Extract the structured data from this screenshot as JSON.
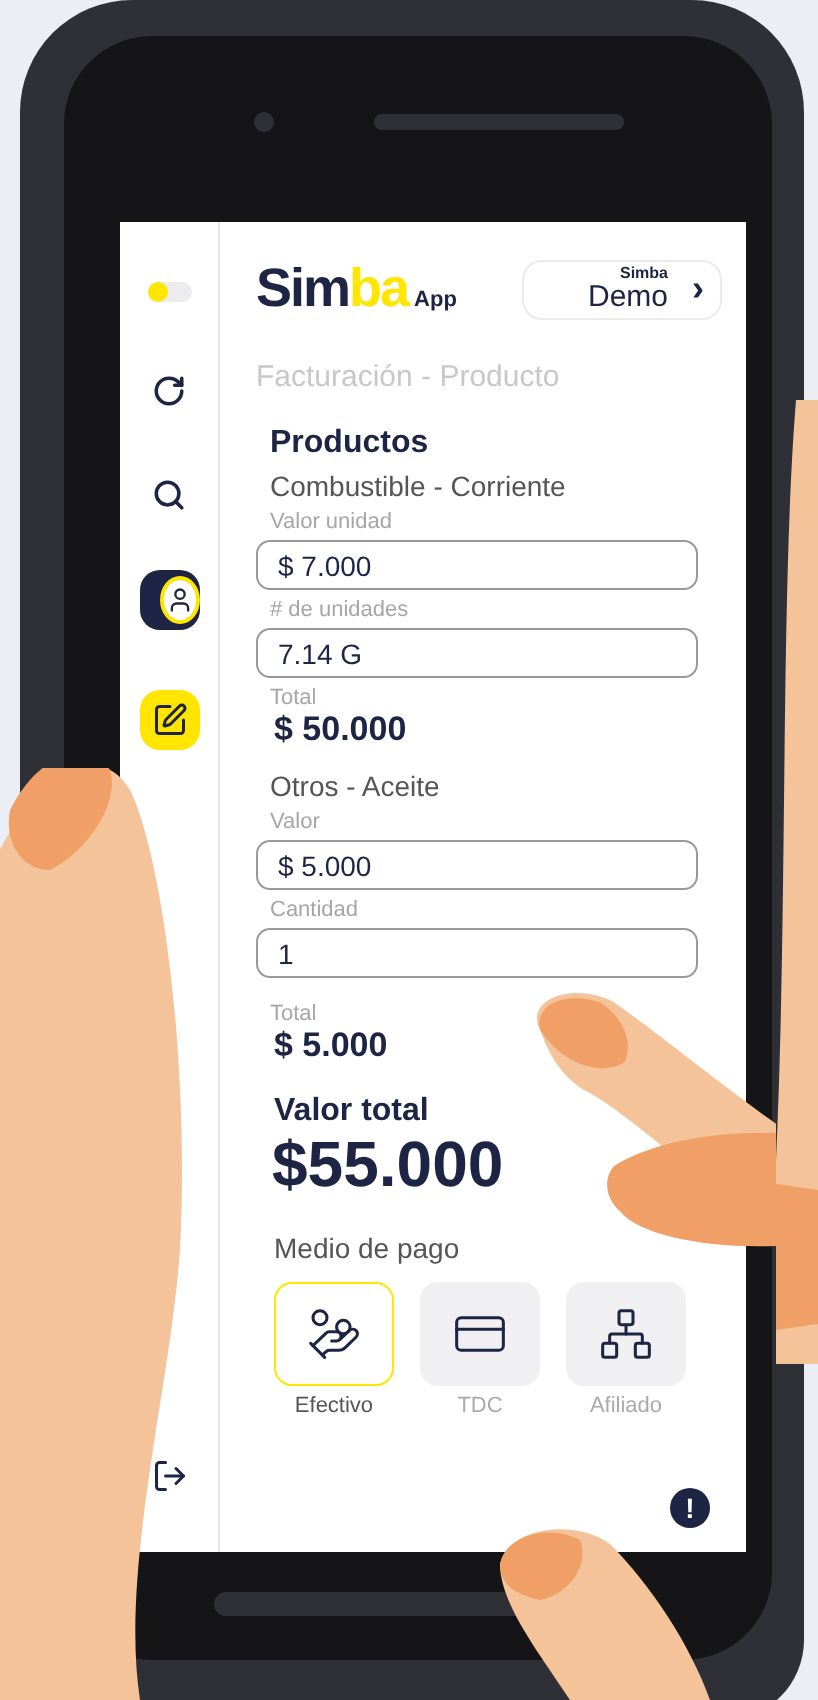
{
  "sidebar": {
    "items": [
      {
        "kind": "toggle",
        "on": false
      },
      {
        "kind": "refresh",
        "selected": false
      },
      {
        "kind": "search",
        "selected": false
      },
      {
        "kind": "profile",
        "selected": false
      },
      {
        "kind": "invoice",
        "selected": true
      },
      {
        "kind": "logout",
        "selected": false
      }
    ]
  },
  "header": {
    "logo": {
      "part_1": "Sim",
      "part_2": "ba",
      "suffix": "App"
    },
    "account_button": {
      "brand": "Simba",
      "name": "Demo",
      "chevron": "›"
    }
  },
  "breadcrumb": "Facturación - Producto",
  "section_title": "Productos",
  "products": [
    {
      "name": "Combustible - Corriente",
      "fields": [
        {
          "label": "Valor unidad",
          "value": "$ 7.000"
        },
        {
          "label": "# de unidades",
          "value": "7.14 G"
        }
      ],
      "total_label": "Total",
      "total": "$ 50.000"
    },
    {
      "name": "Otros - Aceite",
      "fields": [
        {
          "label": "Valor",
          "value": "$ 5.000"
        },
        {
          "label": "Cantidad",
          "value": "1"
        }
      ],
      "total_label": "Total",
      "total": "$ 5.000"
    }
  ],
  "grand_total": {
    "label": "Valor total",
    "value": "$55.000"
  },
  "payment": {
    "label": "Medio de pago",
    "methods": [
      {
        "kind": "cash",
        "label": "Efectivo",
        "selected": true
      },
      {
        "kind": "card",
        "label": "TDC",
        "selected": false
      },
      {
        "kind": "affiliate",
        "label": "Afiliado",
        "selected": false
      }
    ]
  },
  "alert_badge": "!"
}
